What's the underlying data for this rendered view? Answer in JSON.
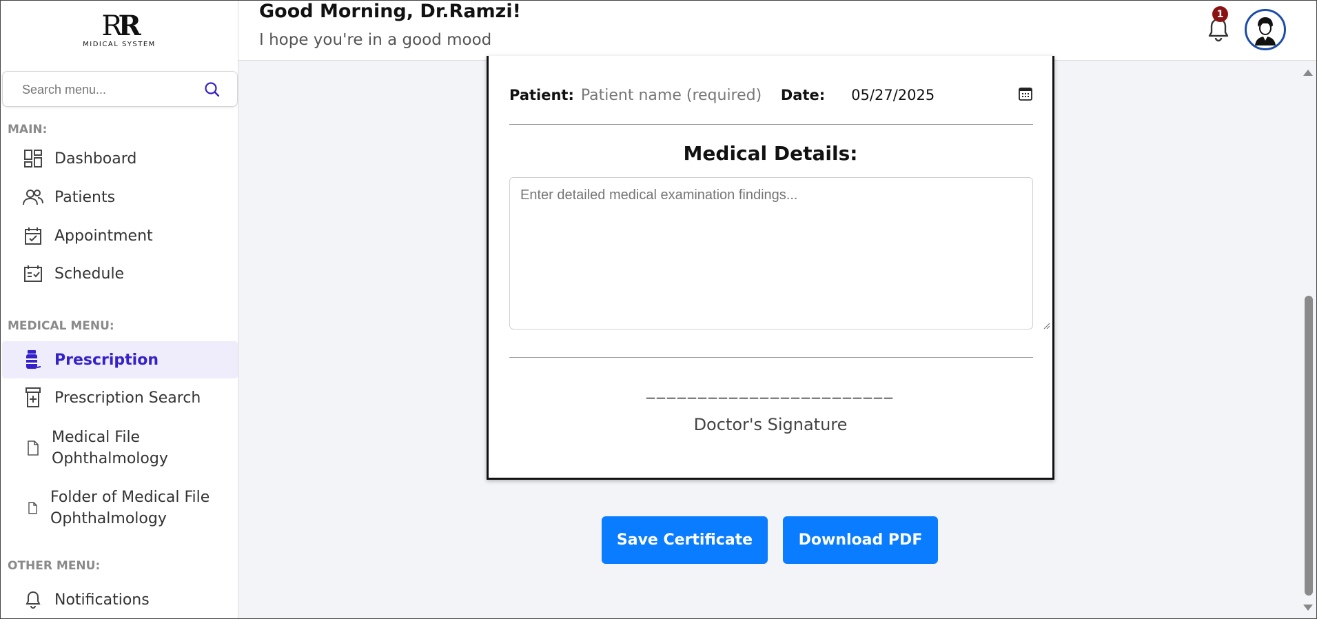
{
  "logo": {
    "mark_r1": "R",
    "mark_r2": "R",
    "text": "MIDICAL SYSTEM"
  },
  "header": {
    "greeting": "Good Morning, Dr.Ramzi!",
    "subgreeting": "I hope you're in a good mood",
    "notification_count": "1"
  },
  "sidebar": {
    "search_placeholder": "Search menu...",
    "sections": {
      "main": "MAIN:",
      "medical": "MEDICAL MENU:",
      "other": "OTHER MENU:"
    },
    "items": {
      "dashboard": "Dashboard",
      "patients": "Patients",
      "appointment": "Appointment",
      "schedule": "Schedule",
      "prescription": "Prescription",
      "prescription_search": "Prescription Search",
      "medical_file_line1": "Medical File",
      "medical_file_line2": "Ophthalmology",
      "folder_line1": "Folder of Medical File",
      "folder_line2": "Ophthalmology",
      "notifications": "Notifications"
    }
  },
  "certificate": {
    "patient_label": "Patient:",
    "patient_placeholder": "Patient name (required)",
    "date_label": "Date:",
    "date_value": "05/27/2025",
    "medical_details_title": "Medical Details:",
    "details_placeholder": "Enter detailed medical examination findings...",
    "signature_line": "________________________",
    "signature_label": "Doctor's Signature"
  },
  "actions": {
    "save": "Save Certificate",
    "download": "Download PDF"
  },
  "colors": {
    "accent": "#0a7cff",
    "active_text": "#3421c9",
    "active_bg": "#efedfc",
    "badge": "#8b1212"
  }
}
